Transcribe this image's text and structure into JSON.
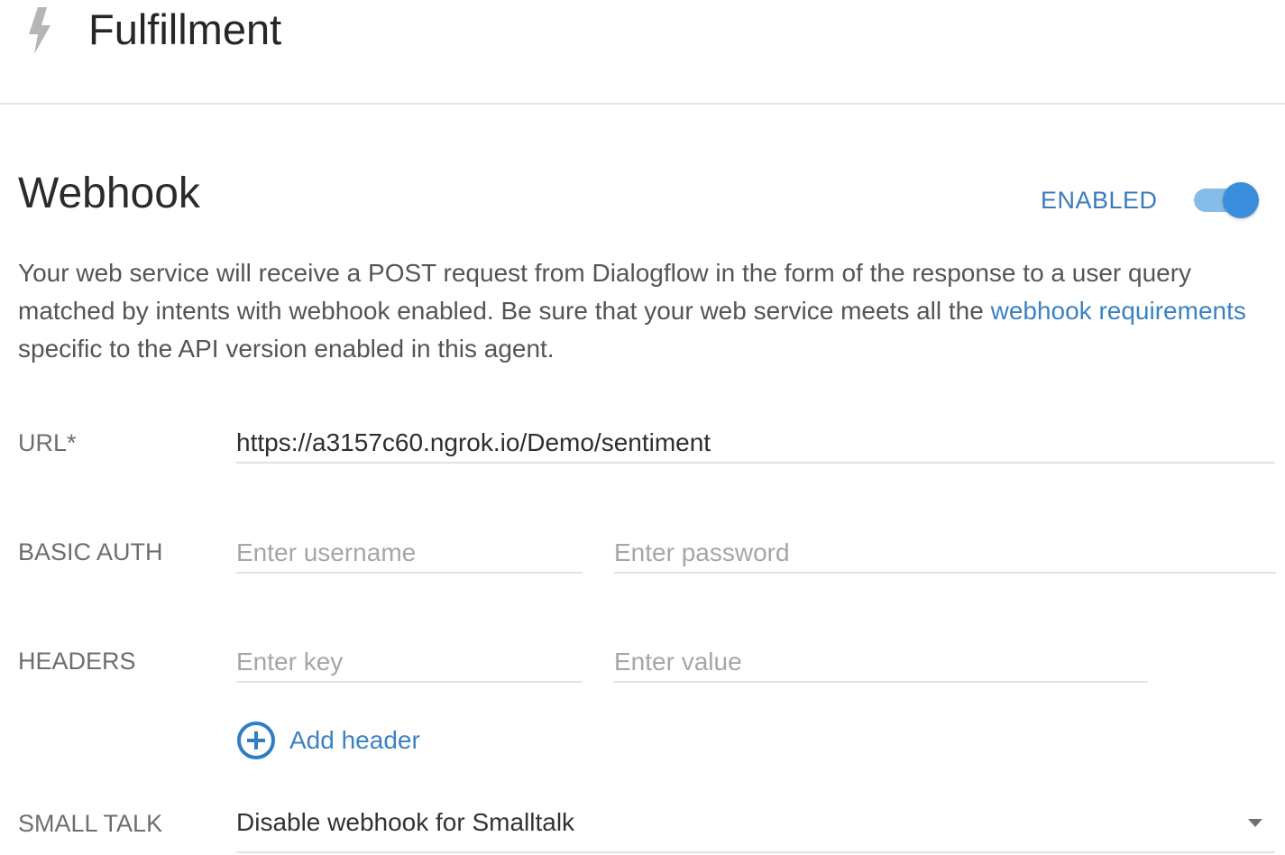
{
  "header": {
    "title": "Fulfillment",
    "icon": "lightning-bolt-icon"
  },
  "webhook": {
    "title": "Webhook",
    "status_label": "ENABLED",
    "toggle_on": true,
    "accent_color": "#3b8edb",
    "description_before": "Your web service will receive a POST request from Dialogflow in the form of the response to a user query matched by intents with webhook enabled. Be sure that your web service meets all the ",
    "description_link": "webhook requirements",
    "description_after": " specific to the API version enabled in this agent."
  },
  "form": {
    "url": {
      "label": "URL*",
      "value": "https://a3157c60.ngrok.io/Demo/sentiment"
    },
    "basic_auth": {
      "label": "BASIC AUTH",
      "username_placeholder": "Enter username",
      "password_placeholder": "Enter password"
    },
    "headers": {
      "label": "HEADERS",
      "key_placeholder": "Enter key",
      "value_placeholder": "Enter value",
      "add_label": "Add header",
      "add_icon": "plus-circle-icon"
    },
    "small_talk": {
      "label": "SMALL TALK",
      "selected": "Disable webhook for Smalltalk",
      "icon": "chevron-down-icon"
    }
  }
}
